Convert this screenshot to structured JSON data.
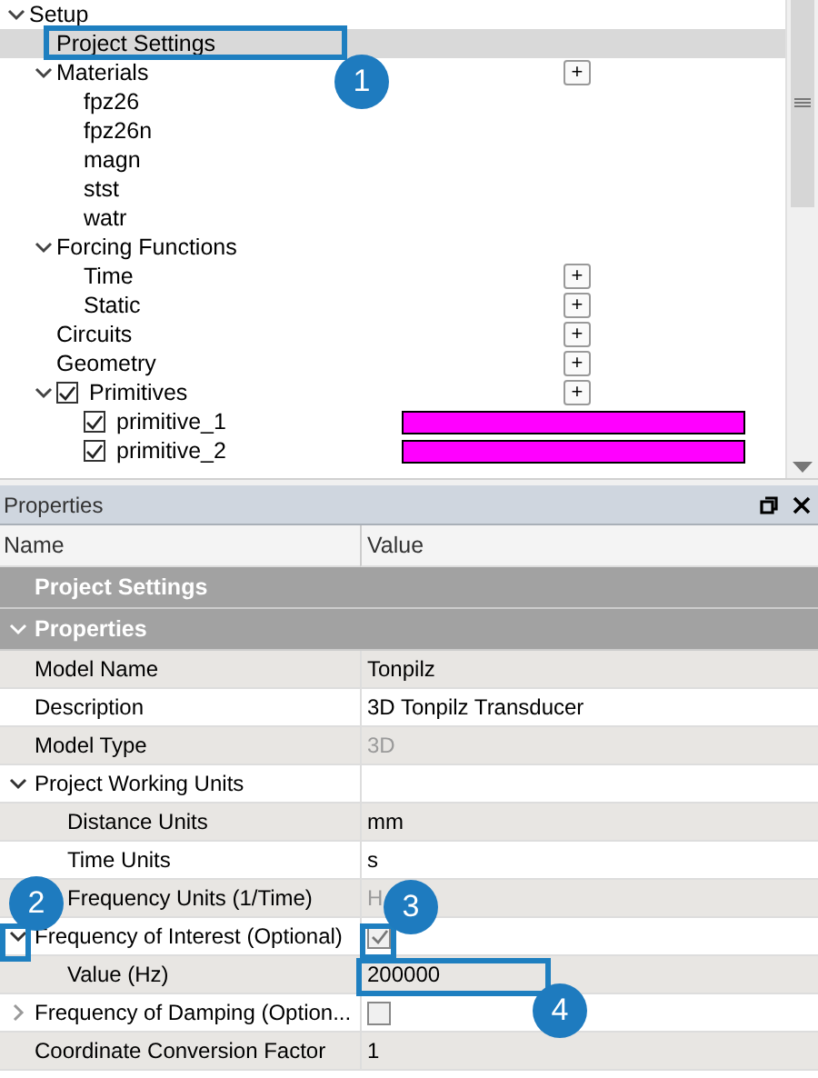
{
  "tree": [
    {
      "label": "Setup",
      "expanded": true,
      "selected": false,
      "children": [
        {
          "label": "Project Settings",
          "selected": true
        },
        {
          "label": "Materials",
          "expanded": true,
          "selected": false,
          "add_button": "+",
          "children": [
            {
              "label": "fpz26",
              "selected": false
            },
            {
              "label": "fpz26n",
              "selected": false
            },
            {
              "label": "magn",
              "selected": false
            },
            {
              "label": "stst",
              "selected": false
            },
            {
              "label": "watr",
              "selected": false
            }
          ]
        },
        {
          "label": "Forcing Functions",
          "expanded": true,
          "selected": false,
          "children": [
            {
              "label": "Time",
              "selected": false,
              "add_button": "+"
            },
            {
              "label": "Static",
              "selected": false,
              "add_button": "+"
            }
          ]
        },
        {
          "label": "Circuits",
          "selected": false,
          "add_button": "+"
        },
        {
          "label": "Geometry",
          "selected": false,
          "add_button": "+"
        },
        {
          "label": "Primitives",
          "expanded": true,
          "checked": true,
          "selected": false,
          "add_button": "+",
          "children": [
            {
              "label": "primitive_1",
              "checked": true,
              "selected": false,
              "color": "#ff00ff"
            },
            {
              "label": "primitive_2",
              "checked": true,
              "selected": false,
              "color": "#ff00ff"
            }
          ]
        }
      ]
    }
  ],
  "properties_panel": {
    "title": "Properties",
    "columns": [
      "Name",
      "Value"
    ],
    "rows": [
      {
        "kind": "category",
        "name": "Project Settings"
      },
      {
        "kind": "category",
        "name": "Properties",
        "expanded": true,
        "children": [
          {
            "kind": "text",
            "name": "Model Name",
            "value": "Tonpilz",
            "disabled": false
          },
          {
            "kind": "text",
            "name": "Description",
            "value": "3D Tonpilz Transducer",
            "disabled": false
          },
          {
            "kind": "text",
            "name": "Model Type",
            "value": "3D",
            "disabled": true
          },
          {
            "kind": "group",
            "name": "Project Working Units",
            "expanded": true,
            "children": [
              {
                "kind": "text",
                "name": "Distance Units",
                "value": "mm",
                "disabled": false
              },
              {
                "kind": "text",
                "name": "Time Units",
                "value": "s",
                "disabled": false
              },
              {
                "kind": "text",
                "name": "Frequency Units (1/Time)",
                "value": "H",
                "disabled": true
              }
            ]
          },
          {
            "kind": "checkbox",
            "name": "Frequency of Interest (Optional)",
            "checked": true,
            "expanded": true,
            "children": [
              {
                "kind": "text",
                "name": "Value (Hz)",
                "value": "200000",
                "disabled": false
              }
            ]
          },
          {
            "kind": "checkbox",
            "name": "Frequency of Damping (Option...",
            "checked": false,
            "expanded": false
          },
          {
            "kind": "text",
            "name": "Coordinate Conversion Factor",
            "value": "1",
            "disabled": false
          }
        ]
      }
    ]
  },
  "callouts": [
    {
      "number": "1"
    },
    {
      "number": "2"
    },
    {
      "number": "3"
    },
    {
      "number": "4"
    }
  ]
}
